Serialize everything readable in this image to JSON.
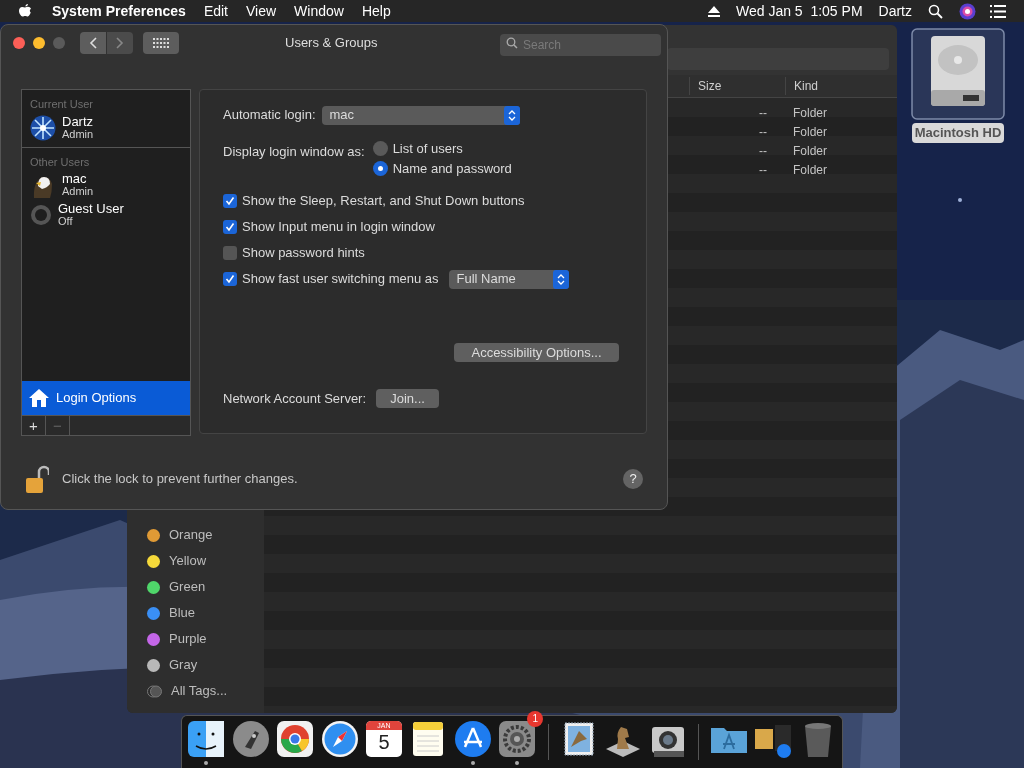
{
  "menu_bar": {
    "app_name": "System Preferences",
    "menus": [
      "Edit",
      "View",
      "Window",
      "Help"
    ],
    "clock": "Wed Jan 5  1:05 PM",
    "user": "Dartz"
  },
  "desktop_icons": [
    {
      "label": "Macintosh HD",
      "selected": true
    }
  ],
  "finder": {
    "columns": [
      "Size",
      "Kind"
    ],
    "rows": [
      {
        "size": "--",
        "kind": "Folder"
      },
      {
        "size": "--",
        "kind": "Folder"
      },
      {
        "size": "--",
        "kind": "Folder"
      },
      {
        "size": "--",
        "kind": "Folder"
      }
    ],
    "tags": [
      {
        "name": "Orange",
        "color": "#e09a35"
      },
      {
        "name": "Yellow",
        "color": "#f5d93a"
      },
      {
        "name": "Green",
        "color": "#4fd66a"
      },
      {
        "name": "Blue",
        "color": "#3a8ff5"
      },
      {
        "name": "Purple",
        "color": "#c466e8"
      },
      {
        "name": "Gray",
        "color": "#b8b8b8"
      },
      {
        "name": "All Tags...",
        "kind": "all"
      }
    ]
  },
  "prefs": {
    "title": "Users & Groups",
    "search": {
      "placeholder": "Search"
    },
    "sections": [
      {
        "header": "Current User",
        "users": [
          {
            "name": "Dartz",
            "role": "Admin",
            "kind": "snowflake",
            "selected": false
          }
        ]
      },
      {
        "header": "Other Users",
        "users": [
          {
            "name": "mac",
            "role": "Admin",
            "kind": "eagle",
            "selected": false
          },
          {
            "name": "Guest User",
            "role": "Off",
            "kind": "guest",
            "selected": false
          }
        ]
      }
    ],
    "login_options": {
      "label": "Login Options",
      "selected": true
    },
    "add_button": {
      "label": "+",
      "disabled": false
    },
    "remove_button": {
      "label": "−",
      "disabled": true
    },
    "automatic_login": {
      "label": "Automatic login:",
      "value": "mac"
    },
    "display_as": {
      "label": "Display login window as:",
      "options": [
        {
          "label": "List of users",
          "selected": false
        },
        {
          "label": "Name and password",
          "selected": true
        }
      ]
    },
    "checkboxes": [
      {
        "label": "Show the Sleep, Restart, and Shut Down buttons",
        "checked": true
      },
      {
        "label": "Show Input menu in login window",
        "checked": true
      },
      {
        "label": "Show password hints",
        "checked": false
      },
      {
        "label": "Show fast user switching menu as",
        "checked": true,
        "dropdown": "Full Name"
      }
    ],
    "accessibility_button": "Accessibility Options...",
    "network": {
      "label": "Network Account Server:",
      "button": "Join..."
    },
    "lock": {
      "text": "Click the lock to prevent further changes.",
      "locked": false
    },
    "help": "?"
  },
  "dock": {
    "items": [
      {
        "kind": "finder",
        "running": true
      },
      {
        "kind": "launchpad",
        "running": false
      },
      {
        "kind": "chrome",
        "running": false
      },
      {
        "kind": "safari",
        "running": false
      },
      {
        "kind": "calendar",
        "running": false,
        "month": "JAN",
        "day": "5"
      },
      {
        "kind": "notes",
        "running": false
      },
      {
        "kind": "appstore",
        "running": true
      },
      {
        "kind": "settings",
        "running": true,
        "badge": "1"
      },
      {
        "kind": "separator"
      },
      {
        "kind": "mail",
        "running": false
      },
      {
        "kind": "chess",
        "running": false
      },
      {
        "kind": "camera",
        "running": false
      },
      {
        "kind": "separator"
      },
      {
        "kind": "folder",
        "running": false
      },
      {
        "kind": "stack",
        "running": false
      },
      {
        "kind": "trash",
        "running": false
      }
    ]
  }
}
